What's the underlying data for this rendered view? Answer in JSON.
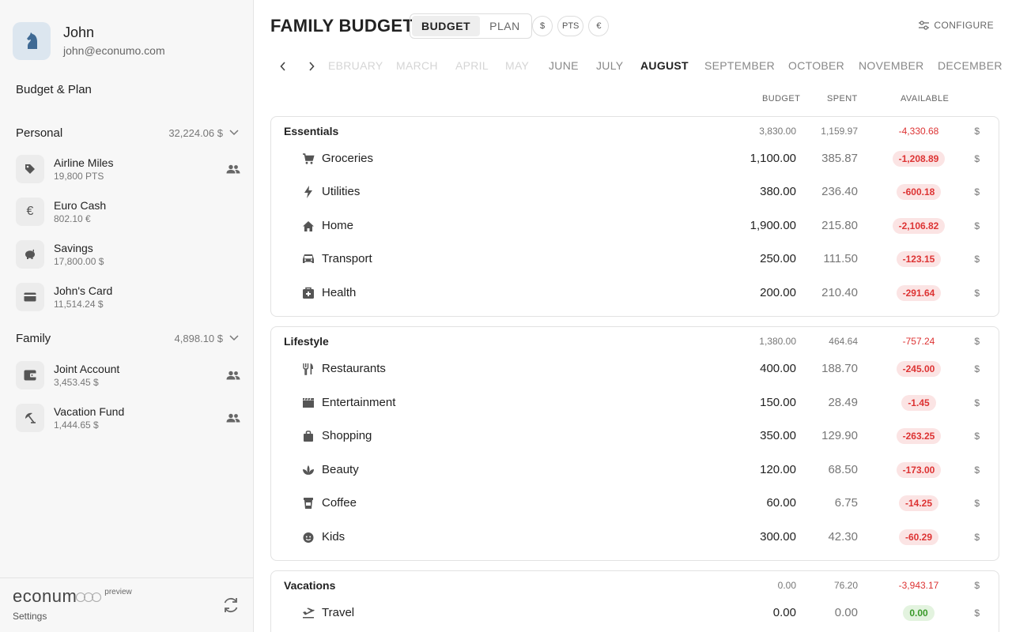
{
  "user": {
    "name": "John",
    "email": "john@econumo.com"
  },
  "nav": {
    "budget_plan": "Budget & Plan"
  },
  "groups": [
    {
      "name": "Personal",
      "total": "32,224.06 $",
      "accounts": [
        {
          "name": "Airline Miles",
          "balance": "19,800 PTS",
          "icon": "tag-icon",
          "shared": true
        },
        {
          "name": "Euro Cash",
          "balance": "802.10 €",
          "icon": "euro-icon",
          "shared": false
        },
        {
          "name": "Savings",
          "balance": "17,800.00 $",
          "icon": "piggy-bank-icon",
          "shared": false
        },
        {
          "name": "John's Card",
          "balance": "11,514.24 $",
          "icon": "credit-card-icon",
          "shared": false
        }
      ]
    },
    {
      "name": "Family",
      "total": "4,898.10 $",
      "accounts": [
        {
          "name": "Joint Account",
          "balance": "3,453.45 $",
          "icon": "wallet-icon",
          "shared": true
        },
        {
          "name": "Vacation Fund",
          "balance": "1,444.65 $",
          "icon": "beach-umbrella-icon",
          "shared": true
        }
      ]
    }
  ],
  "footer": {
    "logo": "econum",
    "preview": "preview",
    "settings": "Settings"
  },
  "header": {
    "title": "FAMILY BUDGET",
    "modes": [
      "BUDGET",
      "PLAN"
    ],
    "active_mode": "BUDGET",
    "currencies": [
      "$",
      "PTS",
      "€"
    ],
    "configure": "CONFIGURE"
  },
  "months": [
    "EBRUARY",
    "MARCH",
    "APRIL",
    "MAY",
    "JUNE",
    "JULY",
    "AUGUST",
    "SEPTEMBER",
    "OCTOBER",
    "NOVEMBER",
    "DECEMBER"
  ],
  "current_month": "AUGUST",
  "columns": {
    "budget": "BUDGET",
    "spent": "SPENT",
    "available": "AVAILABLE"
  },
  "categories": [
    {
      "name": "Essentials",
      "budget": "3,830.00",
      "spent": "1,159.97",
      "available": "-4,330.68",
      "currency": "$",
      "items": [
        {
          "name": "Groceries",
          "icon": "cart-icon",
          "budget": "1,100.00",
          "spent": "385.87",
          "available": "-1,208.89",
          "currency": "$"
        },
        {
          "name": "Utilities",
          "icon": "bolt-icon",
          "budget": "380.00",
          "spent": "236.40",
          "available": "-600.18",
          "currency": "$"
        },
        {
          "name": "Home",
          "icon": "home-icon",
          "budget": "1,900.00",
          "spent": "215.80",
          "available": "-2,106.82",
          "currency": "$"
        },
        {
          "name": "Transport",
          "icon": "car-icon",
          "budget": "250.00",
          "spent": "111.50",
          "available": "-123.15",
          "currency": "$"
        },
        {
          "name": "Health",
          "icon": "medical-bag-icon",
          "budget": "200.00",
          "spent": "210.40",
          "available": "-291.64",
          "currency": "$"
        }
      ]
    },
    {
      "name": "Lifestyle",
      "budget": "1,380.00",
      "spent": "464.64",
      "available": "-757.24",
      "currency": "$",
      "items": [
        {
          "name": "Restaurants",
          "icon": "fork-knife-icon",
          "budget": "400.00",
          "spent": "188.70",
          "available": "-245.00",
          "currency": "$"
        },
        {
          "name": "Entertainment",
          "icon": "clapperboard-icon",
          "budget": "150.00",
          "spent": "28.49",
          "available": "-1.45",
          "currency": "$"
        },
        {
          "name": "Shopping",
          "icon": "shopping-bag-icon",
          "budget": "350.00",
          "spent": "129.90",
          "available": "-263.25",
          "currency": "$"
        },
        {
          "name": "Beauty",
          "icon": "spa-icon",
          "budget": "120.00",
          "spent": "68.50",
          "available": "-173.00",
          "currency": "$"
        },
        {
          "name": "Coffee",
          "icon": "coffee-cup-icon",
          "budget": "60.00",
          "spent": "6.75",
          "available": "-14.25",
          "currency": "$"
        },
        {
          "name": "Kids",
          "icon": "child-face-icon",
          "budget": "300.00",
          "spent": "42.30",
          "available": "-60.29",
          "currency": "$"
        }
      ]
    },
    {
      "name": "Vacations",
      "budget": "0.00",
      "spent": "76.20",
      "available": "-3,943.17",
      "currency": "$",
      "items": [
        {
          "name": "Travel",
          "icon": "plane-icon",
          "budget": "0.00",
          "spent": "0.00",
          "available": "0.00",
          "currency": "$"
        }
      ]
    }
  ]
}
